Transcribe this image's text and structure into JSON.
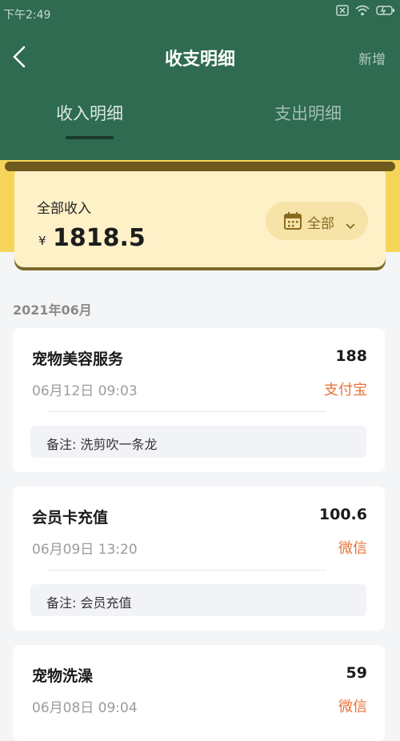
{
  "status_bar": {
    "time": "下午2:49",
    "icons": [
      "close-box-icon",
      "wifi-icon",
      "battery-icon"
    ]
  },
  "nav": {
    "back_icon": "chevron-left-icon",
    "title": "收支明细",
    "add_label": "新增"
  },
  "tabs": [
    {
      "label": "收入明细",
      "active": true
    },
    {
      "label": "支出明细",
      "active": false
    }
  ],
  "summary": {
    "label": "全部收入",
    "currency": "¥",
    "amount": "1818.5",
    "filter_label": "全部",
    "filter_icon": "calendar-icon"
  },
  "month_label": "2021年06月",
  "records": [
    {
      "title": "宠物美容服务",
      "amount": "188",
      "time": "06月12日 09:03",
      "channel": "支付宝",
      "note": "备注: 洗剪吹一条龙"
    },
    {
      "title": "会员卡充值",
      "amount": "100.6",
      "time": "06月09日 13:20",
      "channel": "微信",
      "note": "备注: 会员充值"
    },
    {
      "title": "宠物洗澡",
      "amount": "59",
      "time": "06月08日 09:04",
      "channel": "微信"
    }
  ],
  "colors": {
    "header_green": "#2e6b51",
    "accent_yellow": "#f6d55a",
    "summary_card": "#fef1c8",
    "channel_orange": "#e8733b"
  }
}
